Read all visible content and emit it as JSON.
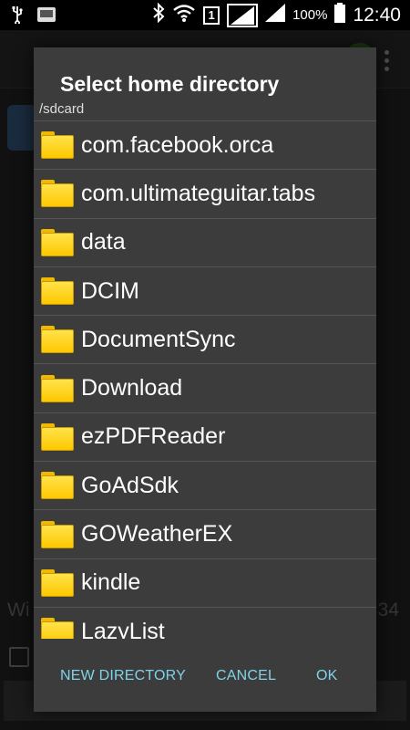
{
  "status_bar": {
    "time": "12:40",
    "battery_percent": "100%",
    "sim_slot": "1",
    "icons": [
      "usb-icon",
      "sd-card-icon",
      "bluetooth-icon",
      "wifi-icon",
      "signal-icon",
      "signal-icon",
      "battery-icon"
    ]
  },
  "background": {
    "text_left": "Wi",
    "text_right": "34"
  },
  "dialog": {
    "title": "Select home directory",
    "path": "/sdcard",
    "folders": [
      "com.facebook.orca",
      "com.ultimateguitar.tabs",
      "data",
      "DCIM",
      "DocumentSync",
      "Download",
      "ezPDFReader",
      "GoAdSdk",
      "GOWeatherEX",
      "kindle",
      "LazyList"
    ],
    "buttons": {
      "new_directory": "NEW DIRECTORY",
      "cancel": "CANCEL",
      "ok": "OK"
    }
  },
  "colors": {
    "accent": "#7fd3e8",
    "folder": "#ffd21a",
    "dialog_bg": "#3c3c3c"
  }
}
